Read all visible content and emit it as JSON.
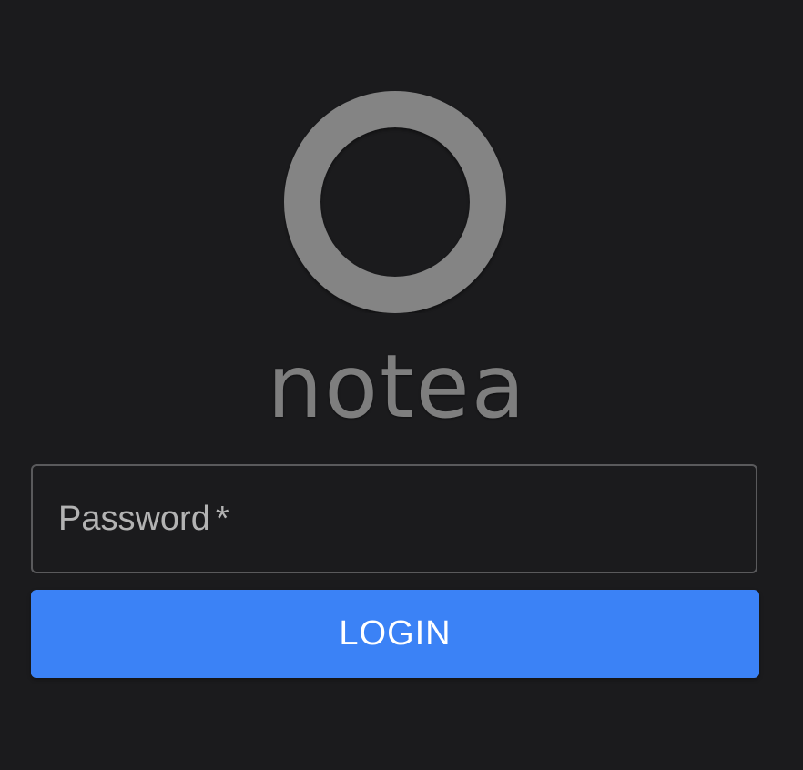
{
  "branding": {
    "wordmark": "notea",
    "logo_icon": "ring-logo-icon",
    "logo_color": "#848484"
  },
  "login_form": {
    "password_label": "Password",
    "required_marker": "*",
    "password_value": "",
    "login_button_label": "LOGIN"
  },
  "colors": {
    "background": "#1b1b1d",
    "button": "#3b82f6",
    "field_border": "#5a5a5c"
  }
}
